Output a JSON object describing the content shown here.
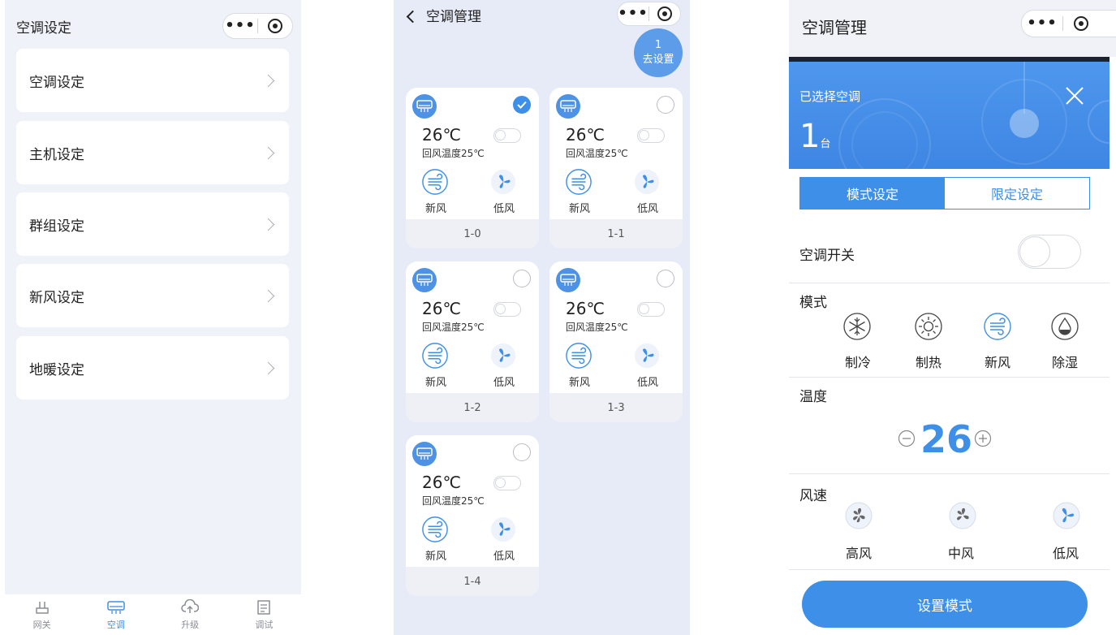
{
  "screen1": {
    "title": "空调设定",
    "menu": [
      {
        "label": "空调设定"
      },
      {
        "label": "主机设定"
      },
      {
        "label": "群组设定"
      },
      {
        "label": "新风设定"
      },
      {
        "label": "地暖设定"
      }
    ],
    "tabs": [
      {
        "label": "网关",
        "icon": "gateway-icon"
      },
      {
        "label": "空调",
        "icon": "ac-icon",
        "active": true
      },
      {
        "label": "升级",
        "icon": "cloud-upload-icon"
      },
      {
        "label": "调试",
        "icon": "debug-icon"
      }
    ]
  },
  "screen2": {
    "title": "空调管理",
    "go_button": {
      "count": "1",
      "label": "去设置"
    },
    "cards": [
      {
        "id": "1-0",
        "temp": "26℃",
        "return_temp": "回风温度25℃",
        "mode": "新风",
        "fan": "低风",
        "checked": true
      },
      {
        "id": "1-1",
        "temp": "26℃",
        "return_temp": "回风温度25℃",
        "mode": "新风",
        "fan": "低风",
        "checked": false
      },
      {
        "id": "1-2",
        "temp": "26℃",
        "return_temp": "回风温度25℃",
        "mode": "新风",
        "fan": "低风",
        "checked": false
      },
      {
        "id": "1-3",
        "temp": "26℃",
        "return_temp": "回风温度25℃",
        "mode": "新风",
        "fan": "低风",
        "checked": false
      },
      {
        "id": "1-4",
        "temp": "26℃",
        "return_temp": "回风温度25℃",
        "mode": "新风",
        "fan": "低风",
        "checked": false
      }
    ]
  },
  "screen3": {
    "title": "空调管理",
    "banner": {
      "label": "已选择空调",
      "count": "1",
      "unit": "台"
    },
    "segments": {
      "active": "模式设定",
      "inactive": "限定设定"
    },
    "power_label": "空调开关",
    "mode": {
      "title": "模式",
      "options": [
        {
          "label": "制冷",
          "icon": "snowflake-icon"
        },
        {
          "label": "制热",
          "icon": "sun-icon"
        },
        {
          "label": "新风",
          "icon": "fresh-air-icon"
        },
        {
          "label": "除湿",
          "icon": "droplet-icon"
        }
      ]
    },
    "temperature": {
      "title": "温度",
      "value": "26"
    },
    "fan": {
      "title": "风速",
      "options": [
        {
          "label": "高风"
        },
        {
          "label": "中风"
        },
        {
          "label": "低风"
        }
      ]
    },
    "submit_label": "设置模式"
  },
  "colors": {
    "accent": "#3d8fe8",
    "page_bg": "#f0f2fa",
    "card_bg": "#ffffff"
  }
}
